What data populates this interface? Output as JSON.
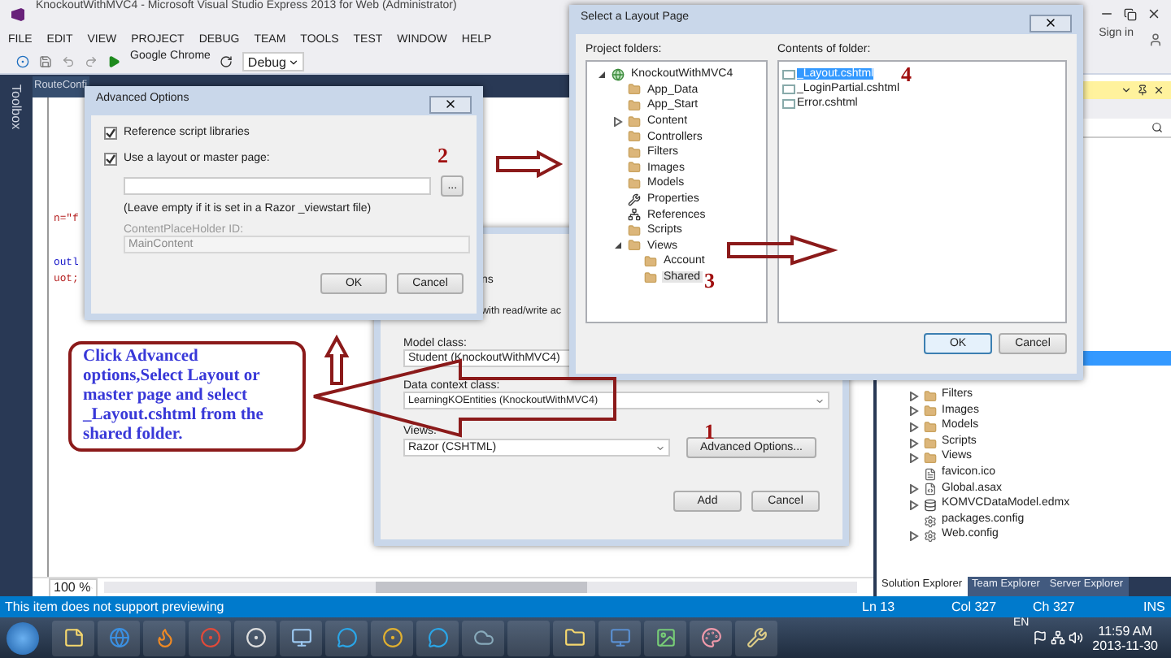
{
  "window": {
    "title": "KnockoutWithMVC4 - Microsoft Visual Studio Express 2013 for Web (Administrator)",
    "sign_in": "Sign in"
  },
  "menu": [
    "FILE",
    "EDIT",
    "VIEW",
    "PROJECT",
    "DEBUG",
    "TEAM",
    "TOOLS",
    "TEST",
    "WINDOW",
    "HELP"
  ],
  "toolbar": {
    "browser": "Google Chrome",
    "configuration": "Debug"
  },
  "toolbox": {
    "label": "Toolbox"
  },
  "editor": {
    "tab": "RouteConfi",
    "code": [
      {
        "text": "n=\"f",
        "kind": "string"
      },
      {
        "text": "outl",
        "kind": "keyword"
      },
      {
        "text": "uot;",
        "kind": "string"
      }
    ],
    "zoom": "100 %"
  },
  "solution_explorer": {
    "items": [
      {
        "label": "Filters",
        "kind": "folder",
        "expanded": false
      },
      {
        "label": "Images",
        "kind": "folder",
        "expanded": false
      },
      {
        "label": "Models",
        "kind": "folder",
        "expanded": false
      },
      {
        "label": "Scripts",
        "kind": "folder",
        "expanded": false
      },
      {
        "label": "Views",
        "kind": "folder",
        "expanded": false
      },
      {
        "label": "favicon.ico",
        "kind": "file"
      },
      {
        "label": "Global.asax",
        "kind": "code",
        "expanded": false
      },
      {
        "label": "KOMVCDataModel.edmx",
        "kind": "model",
        "expanded": false
      },
      {
        "label": "packages.config",
        "kind": "config"
      },
      {
        "label": "Web.config",
        "kind": "config",
        "expanded": false
      }
    ],
    "tabs": [
      {
        "label": "Solution Explorer",
        "selected": true
      },
      {
        "label": "Team Explorer",
        "selected": false
      },
      {
        "label": "Server Explorer",
        "selected": false
      }
    ]
  },
  "status_bar": {
    "message": "This item does not support previewing",
    "line": "Ln 13",
    "column": "Col 327",
    "char": "Ch 327",
    "mode": "INS"
  },
  "taskbar": {
    "language": "EN",
    "time": "11:59 AM",
    "date": "2013-11-30"
  },
  "add_view_dialog": {
    "partial_labels": [
      "ns",
      "with read/write ac"
    ],
    "model_class_label": "Model class:",
    "model_class": "Student (KnockoutWithMVC4)",
    "data_context_label": "Data context class:",
    "data_context": "LearningKOEntities (KnockoutWithMVC4)",
    "views_label": "Views:",
    "view_engine": "Razor (CSHTML)",
    "advanced_button": "Advanced Options...",
    "buttons": [
      "Add",
      "Cancel"
    ]
  },
  "advanced_options": {
    "title": "Advanced Options",
    "options": [
      {
        "label": "Reference script libraries",
        "checked": true
      },
      {
        "label": "Use a layout or master page:",
        "checked": true
      }
    ],
    "browse": "...",
    "hint": "(Leave empty if it is set in a Razor _viewstart file)",
    "placeholder_label": "ContentPlaceHolder ID:",
    "placeholder_value": "MainContent",
    "buttons": [
      "OK",
      "Cancel"
    ]
  },
  "layout_dialog": {
    "title": "Select a Layout Page",
    "folders_label": "Project folders:",
    "contents_label": "Contents of folder:",
    "folders": [
      {
        "label": "KnockoutWithMVC4",
        "kind": "project",
        "expanded": true,
        "selected": false,
        "children": [
          {
            "label": "App_Data",
            "kind": "folder",
            "selected": false
          },
          {
            "label": "App_Start",
            "kind": "folder",
            "selected": false
          },
          {
            "label": "Content",
            "kind": "folder",
            "expanded": false,
            "selected": false
          },
          {
            "label": "Controllers",
            "kind": "folder",
            "selected": false
          },
          {
            "label": "Filters",
            "kind": "folder",
            "selected": false
          },
          {
            "label": "Images",
            "kind": "folder",
            "selected": false
          },
          {
            "label": "Models",
            "kind": "folder",
            "selected": false
          },
          {
            "label": "Properties",
            "kind": "properties",
            "selected": false
          },
          {
            "label": "References",
            "kind": "references",
            "selected": false
          },
          {
            "label": "Scripts",
            "kind": "folder",
            "selected": false
          },
          {
            "label": "Views",
            "kind": "folder",
            "expanded": true,
            "selected": false,
            "children": [
              {
                "label": "Account",
                "kind": "folder",
                "selected": false
              },
              {
                "label": "Shared",
                "kind": "folder",
                "selected": true
              }
            ]
          }
        ]
      }
    ],
    "files": [
      {
        "label": "_Layout.cshtml",
        "selected": true
      },
      {
        "label": "_LoginPartial.cshtml",
        "selected": false
      },
      {
        "label": "Error.cshtml",
        "selected": false
      }
    ],
    "buttons": [
      "OK",
      "Cancel"
    ]
  },
  "annotations": {
    "steps": [
      "1",
      "2",
      "3",
      "4"
    ],
    "callout": "Click Advanced options,Select Layout or master page and select _Layout.cshtml from the shared folder."
  }
}
